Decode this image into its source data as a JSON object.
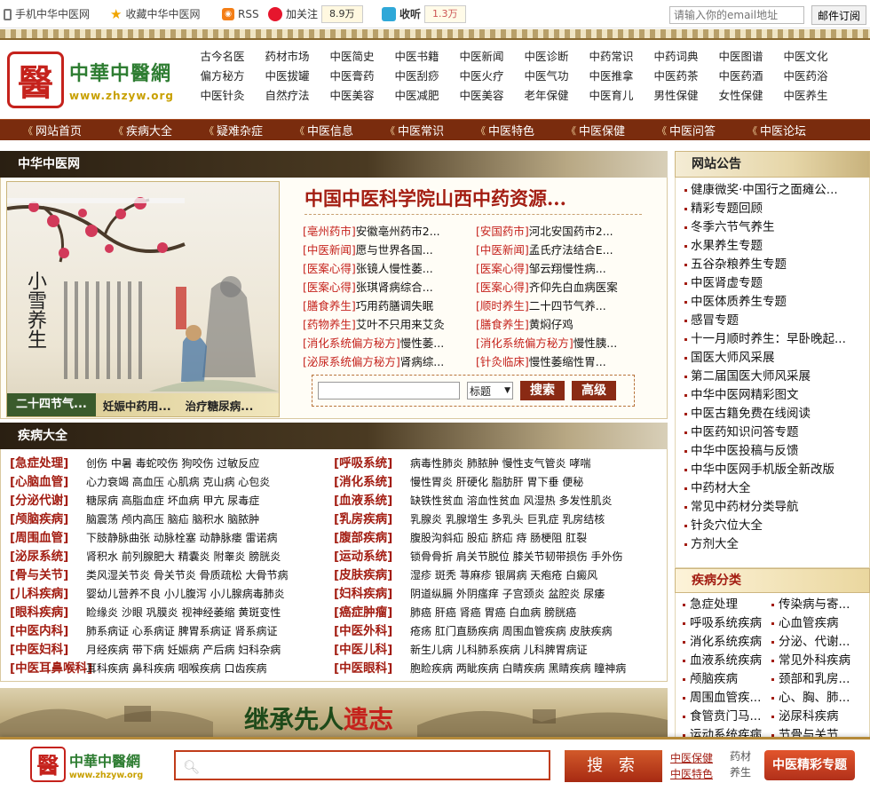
{
  "topbar": {
    "mobile": "手机中华中医网",
    "favorite": "收藏中华中医网",
    "rss": "RSS",
    "weibo_follow": "加关注",
    "weibo_count": "8.9万",
    "tencent_follow": "收听",
    "tencent_count": "1.3万",
    "email_placeholder": "请输入你的email地址",
    "subscribe_button": "邮件订阅"
  },
  "logo": {
    "cn": "中華中醫網",
    "url": "www.zhzyw.org",
    "seal": "醫"
  },
  "header_links": [
    "古今名医",
    "药材市场",
    "中医简史",
    "中医书籍",
    "中医新闻",
    "中医诊断",
    "中药常识",
    "中药词典",
    "中医图谱",
    "中医文化",
    "偏方秘方",
    "中医拔罐",
    "中医膏药",
    "中医刮痧",
    "中医火疗",
    "中医气功",
    "中医推拿",
    "中医药茶",
    "中医药酒",
    "中医药浴",
    "中医针灸",
    "自然疗法",
    "中医美容",
    "中医减肥",
    "中医美容",
    "老年保健",
    "中医育儿",
    "男性保健",
    "女性保健",
    "中医养生"
  ],
  "nav": [
    "网站首页",
    "疾病大全",
    "疑难杂症",
    "中医信息",
    "中医常识",
    "中医特色",
    "中医保健",
    "中医问答",
    "中医论坛"
  ],
  "feature": {
    "section_title": "中华中医网",
    "poem": "小雪养生",
    "caption": [
      "二十四节气...",
      "妊娠中药用...",
      "治疗糖尿病..."
    ],
    "headline": "中国中医科学院山西中药资源...",
    "news": [
      [
        {
          "tag": "[亳州药市]",
          "text": "安徽亳州药市2..."
        },
        {
          "tag": "[安国药市]",
          "text": "河北安国药市2..."
        }
      ],
      [
        {
          "tag": "[中医新闻]",
          "text": "愿与世界各国..."
        },
        {
          "tag": "[中医新闻]",
          "text": "孟氏疗法结合E..."
        }
      ],
      [
        {
          "tag": "[医案心得]",
          "text": "张镜人慢性萎..."
        },
        {
          "tag": "[医案心得]",
          "text": "邹云翔慢性病..."
        }
      ],
      [
        {
          "tag": "[医案心得]",
          "text": "张琪肾病综合..."
        },
        {
          "tag": "[医案心得]",
          "text": "齐仰先白血病医案"
        }
      ],
      [
        {
          "tag": "[膳食养生]",
          "text": "巧用药膳调失眠"
        },
        {
          "tag": "[顺时养生]",
          "text": "二十四节气养..."
        }
      ],
      [
        {
          "tag": "[药物养生]",
          "text": "艾叶不只用来艾灸"
        },
        {
          "tag": "[膳食养生]",
          "text": "黄焖仔鸡"
        }
      ],
      [
        {
          "tag": "[消化系统偏方秘方]",
          "text": "慢性萎..."
        },
        {
          "tag": "[消化系统偏方秘方]",
          "text": "慢性胰..."
        }
      ],
      [
        {
          "tag": "[泌尿系统偏方秘方]",
          "text": "肾病综..."
        },
        {
          "tag": "[针灸临床]",
          "text": "慢性萎缩性胃..."
        }
      ]
    ],
    "search_select": "标题",
    "search_button": "搜索",
    "advanced_button": "高级"
  },
  "diseases": {
    "section_title": "疾病大全",
    "rows": [
      [
        {
          "cat": "[急症处理]",
          "items": "创伤 中暑 毒蛇咬伤 狗咬伤 过敏反应"
        },
        {
          "cat": "[呼吸系统]",
          "items": "病毒性肺炎 肺脓肿 慢性支气管炎 哮喘"
        }
      ],
      [
        {
          "cat": "[心脑血管]",
          "items": "心力衰竭 高血压 心肌病 克山病 心包炎"
        },
        {
          "cat": "[消化系统]",
          "items": "慢性胃炎 肝硬化 脂肪肝 胃下垂 便秘"
        }
      ],
      [
        {
          "cat": "[分泌代谢]",
          "items": "糖尿病 高脂血症 坏血病 甲亢 尿毒症"
        },
        {
          "cat": "[血液系统]",
          "items": "缺铁性贫血 溶血性贫血 风湿热 多发性肌炎"
        }
      ],
      [
        {
          "cat": "[颅脑疾病]",
          "items": "脑震荡 颅内高压 脑疝 脑积水 脑脓肿"
        },
        {
          "cat": "[乳房疾病]",
          "items": "乳腺炎 乳腺增生 多乳头 巨乳症 乳房结核"
        }
      ],
      [
        {
          "cat": "[周围血管]",
          "items": "下肢静脉曲张 动脉栓塞 动静脉瘘 雷诺病"
        },
        {
          "cat": "[腹部疾病]",
          "items": "腹股沟斜疝 股疝 脐疝 痔 肠梗阻 肛裂"
        }
      ],
      [
        {
          "cat": "[泌尿系统]",
          "items": "肾积水 前列腺肥大 精囊炎 附睾炎 膀胱炎"
        },
        {
          "cat": "[运动系统]",
          "items": "锁骨骨折 肩关节脱位 膝关节韧带损伤 手外伤"
        }
      ],
      [
        {
          "cat": "[骨与关节]",
          "items": "类风湿关节炎 骨关节炎 骨质疏松 大骨节病"
        },
        {
          "cat": "[皮肤疾病]",
          "items": "湿疹 斑秃 荨麻疹 银屑病 天疱疮 白癜风"
        }
      ],
      [
        {
          "cat": "[儿科疾病]",
          "items": "婴幼儿营养不良 小儿腹泻 小儿腺病毒肺炎"
        },
        {
          "cat": "[妇科疾病]",
          "items": "阴道纵膈 外阴瘙痒 子宫颈炎 盆腔炎 尿痿"
        }
      ],
      [
        {
          "cat": "[眼科疾病]",
          "items": "睑缘炎 沙眼 巩膜炎 视神经萎缩 黄斑变性"
        },
        {
          "cat": "[癌症肿瘤]",
          "items": "肺癌 肝癌 肾癌 胃癌 白血病 膀胱癌"
        }
      ],
      [
        {
          "cat": "[中医内科]",
          "items": "肺系病证 心系病证 脾胃系病证 肾系病证"
        },
        {
          "cat": "[中医外科]",
          "items": "疮疡 肛门直肠疾病 周围血管疾病 皮肤疾病"
        }
      ],
      [
        {
          "cat": "[中医妇科]",
          "items": "月经疾病 带下病 妊娠病 产后病 妇科杂病"
        },
        {
          "cat": "[中医儿科]",
          "items": "新生儿病 儿科肺系疾病 儿科脾胃病证"
        }
      ],
      [
        {
          "cat": "[中医耳鼻喉科]",
          "items": "耳科疾病 鼻科疾病 咽喉疾病 口齿疾病"
        },
        {
          "cat": "[中医眼科]",
          "items": "胞睑疾病 两眦疾病 白睛疾病 黑睛疾病 瞳神病"
        }
      ]
    ]
  },
  "slogan": {
    "a": "继承先人",
    "b": "遗志"
  },
  "announce": {
    "title": "网站公告",
    "items": [
      "健康微奖·中国行之面瘫公...",
      "精彩专题回顾",
      "冬季六节气养生",
      "水果养生专题",
      "五谷杂粮养生专题",
      "中医肾虚专题",
      "中医体质养生专题",
      "感冒专题",
      "十一月顺时养生：早卧晚起...",
      "国医大师风采展",
      "第二届国医大师风采展",
      "中华中医网精彩图文",
      "中医古籍免费在线阅读",
      "中医药知识问答专题",
      "中华中医投稿与反馈",
      "中华中医网手机版全新改版",
      "中药材大全",
      "常见中药材分类导航",
      "针灸穴位大全",
      "方剂大全"
    ]
  },
  "disease_cats": {
    "title": "疾病分类",
    "items": [
      "急症处理",
      "传染病与寄...",
      "呼吸系统疾病",
      "心血管疾病",
      "消化系统疾病",
      "分泌、代谢...",
      "血液系统疾病",
      "常见外科疾病",
      "颅脑疾病",
      "颈部和乳房...",
      "周围血管疾...",
      "心、胸、肺...",
      "食管贲门马...",
      "泌尿科疾病",
      "运动系统疾病",
      "节骨与关节..."
    ]
  },
  "footer": {
    "logo_cn": "中華中醫網",
    "logo_url": "www.zhzyw.org",
    "search_button": "搜 索",
    "links": [
      "中医保健",
      "中医特色"
    ],
    "mini": [
      "药材",
      "养生"
    ],
    "special": "中医精彩专题"
  }
}
